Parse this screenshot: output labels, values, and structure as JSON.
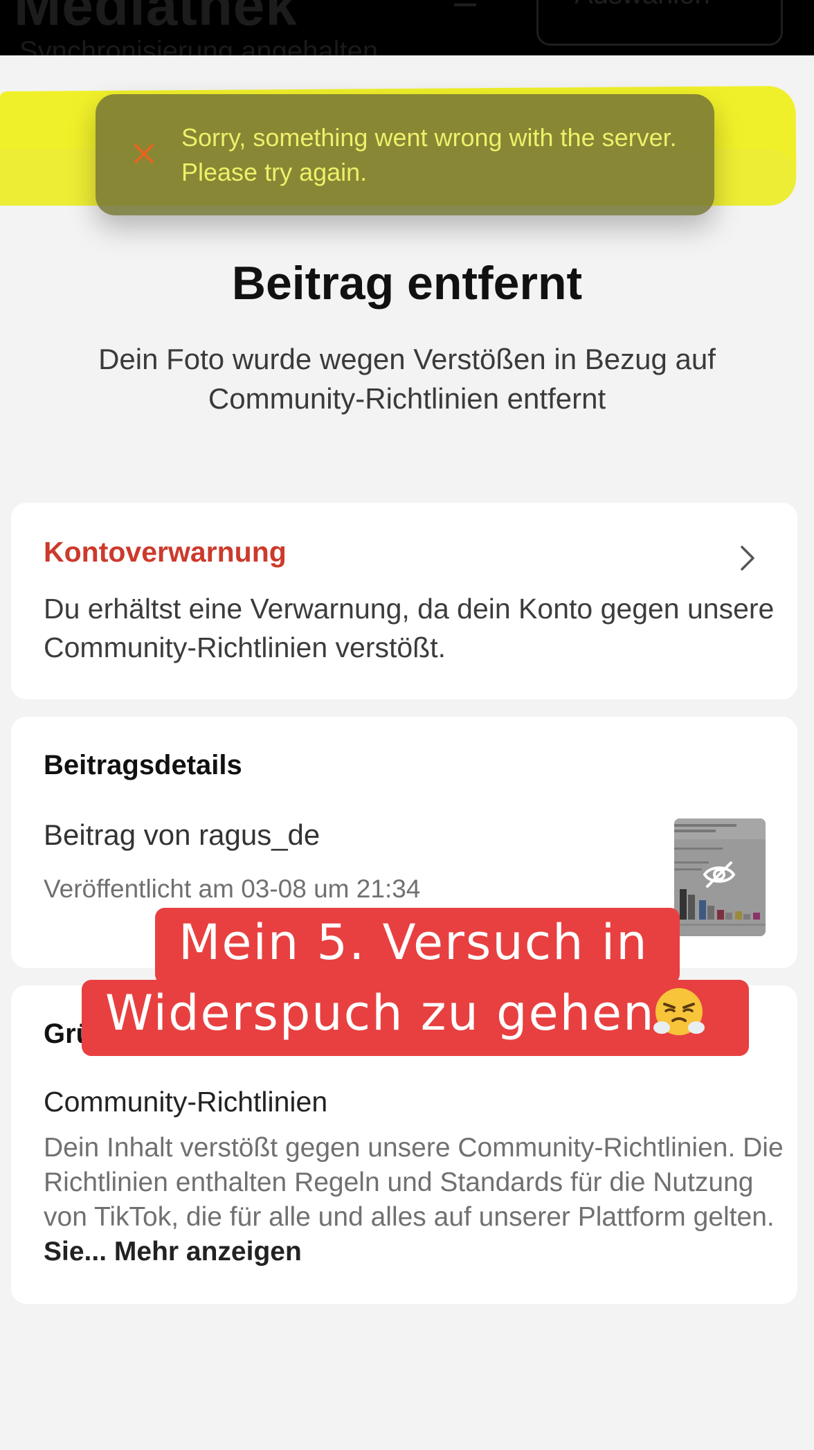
{
  "background_app": {
    "title_fragment": "Mediathek",
    "subtitle_fragment": "Synchronisierung angehalten",
    "right_fragment": "Auswählen"
  },
  "toast": {
    "message": "Sorry, something went wrong with the server. Please try again.",
    "icon": "close-icon",
    "text_color": "#eef06a",
    "highlight_color": "#f0f02a"
  },
  "page": {
    "title": "Beitrag entfernt",
    "subtitle": "Dein Foto wurde wegen Verstößen in Bezug auf Community-Richtlinien entfernt"
  },
  "account_warning": {
    "title": "Kontoverwarnung",
    "body": "Du erhältst eine Verwarnung, da dein Konto gegen unsere Community-Richtlinien verstößt.",
    "title_color": "#cc3a2c",
    "icon": "chevron-right-icon"
  },
  "post_details": {
    "heading": "Beitragsdetails",
    "post_by": "Beitrag von ragus_de",
    "published": "Veröffentlicht am 03-08 um 21:34",
    "thumbnail_icon": "eye-hidden-icon"
  },
  "reason": {
    "heading": "Grü",
    "subheading": "Community-Richtlinien",
    "body": "Dein Inhalt verstößt gegen unsere Community-Richtlinien. Die Richtlinien enthalten Regeln und Standards für die Nutzung von TikTok, die für alle und alles auf unserer Plattform gelten. ",
    "body_tail": "Sie",
    "more_link": "... Mehr anzeigen"
  },
  "caption": {
    "line1": "Mein 5. Versuch in",
    "line2": "Widerspuch zu gehen",
    "emoji": "angry-steam-face-emoji",
    "color": "#e84040"
  }
}
